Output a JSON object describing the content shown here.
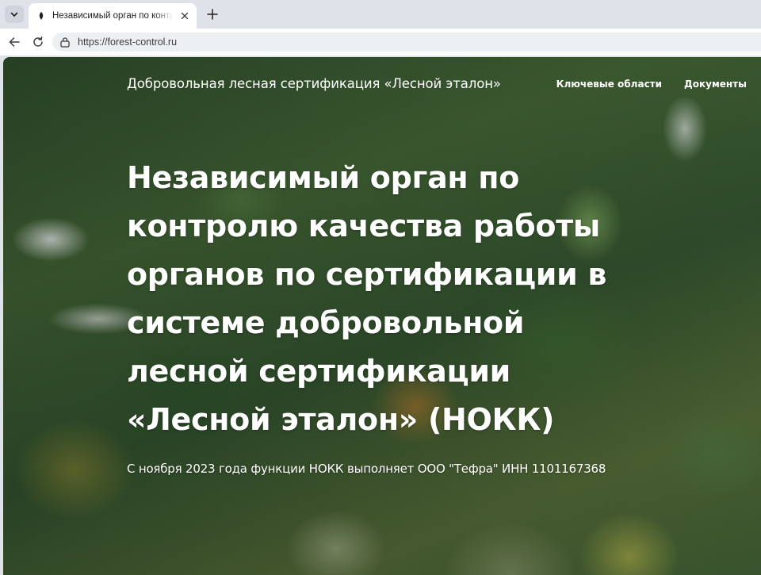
{
  "browser": {
    "tab": {
      "title": "Независимый орган по контролю качества работы органов по сертификации"
    },
    "url": "https://forest-control.ru"
  },
  "icons": {
    "tab_list": "chevron-down-icon",
    "favicon": "page-favicon-icon",
    "tab_close": "close-icon",
    "new_tab": "plus-icon",
    "back": "arrow-left-icon",
    "reload": "reload-icon",
    "site_info": "site-info-icon"
  },
  "site": {
    "brand": "Добровольная лесная сертификация «Лесной эталон»",
    "nav": [
      {
        "label": "Ключевые области"
      },
      {
        "label": "Документы"
      }
    ]
  },
  "hero": {
    "title": "Независимый орган по контролю качества работы органов по сертификации в системе добровольной лесной сертификации «Лесной эталон» (НОКК)",
    "subtitle": "С ноября 2023 года функции НОКК выполняет ООО \"Тефра\" ИНН 1101167368"
  },
  "colors": {
    "chrome_bg": "#dfe3e9",
    "toolbar_bg": "#ffffff",
    "omnibox_bg": "#edf0f3",
    "text_on_hero": "#ffffff"
  }
}
